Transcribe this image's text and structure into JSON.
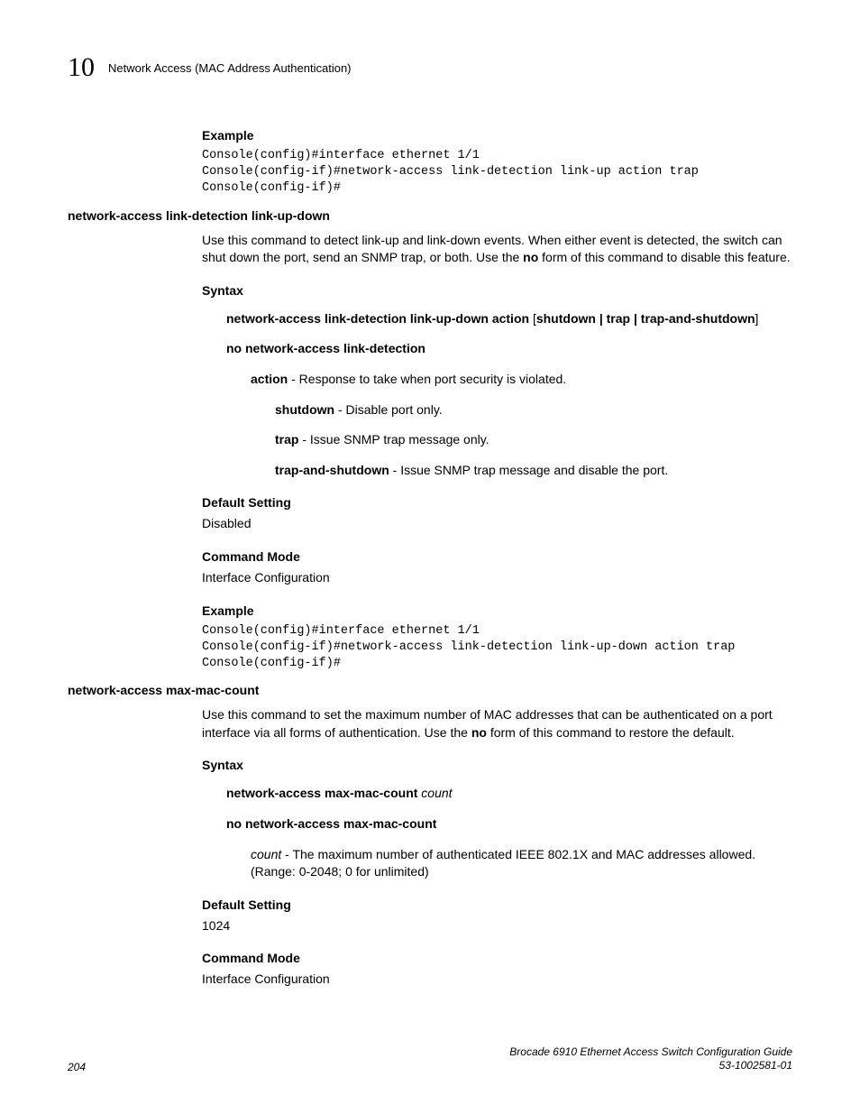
{
  "header": {
    "chapter": "10",
    "title": "Network Access (MAC Address Authentication)"
  },
  "sec1": {
    "example_head": "Example",
    "code1": "Console(config)#interface ethernet 1/1\nConsole(config-if)#network-access link-detection link-up action trap\nConsole(config-if)#"
  },
  "cmd1": {
    "name": "network-access link-detection link-up-down",
    "desc_a": "Use this command to detect link-up and link-down events. When either event is detected, the switch can shut down the port, send an SNMP trap, or both. Use the ",
    "desc_no": "no",
    "desc_b": " form of this command to disable this feature.",
    "syntax_head": "Syntax",
    "syntax_line": "network-access link-detection link-up-down action",
    "syntax_bracket": " [",
    "syntax_opts": "shutdown | trap | trap-and-shutdown",
    "syntax_close": "]",
    "no_syntax": "no network-access link-detection",
    "action_b": "action",
    "action_t": " - Response to take when port security is violated.",
    "shut_b": "shutdown",
    "shut_t": " - Disable port only.",
    "trap_b": "trap",
    "trap_t": " - Issue SNMP trap message only.",
    "tas_b": "trap-and-shutdown",
    "tas_t": " - Issue SNMP trap message and disable the port.",
    "default_head": "Default Setting",
    "default_val": "Disabled",
    "mode_head": "Command Mode",
    "mode_val": "Interface Configuration",
    "example_head": "Example",
    "code": "Console(config)#interface ethernet 1/1\nConsole(config-if)#network-access link-detection link-up-down action trap\nConsole(config-if)#"
  },
  "cmd2": {
    "name": "network-access max-mac-count",
    "desc_a": "Use this command to set the maximum number of MAC addresses that can be authenticated on a port interface via all forms of authentication. Use the ",
    "desc_no": "no",
    "desc_b": " form of this command to restore the default.",
    "syntax_head": "Syntax",
    "syntax_b": "network-access max-mac-count",
    "syntax_i": " count",
    "no_syntax": "no network-access max-mac-count",
    "count_i": "count",
    "count_t": " - The maximum number of authenticated IEEE 802.1X and MAC addresses allowed. (Range: 0-2048; 0 for unlimited)",
    "default_head": "Default Setting",
    "default_val": "1024",
    "mode_head": "Command Mode",
    "mode_val": "Interface Configuration"
  },
  "footer": {
    "page": "204",
    "guide": "Brocade 6910 Ethernet Access Switch Configuration Guide",
    "doc": "53-1002581-01"
  }
}
